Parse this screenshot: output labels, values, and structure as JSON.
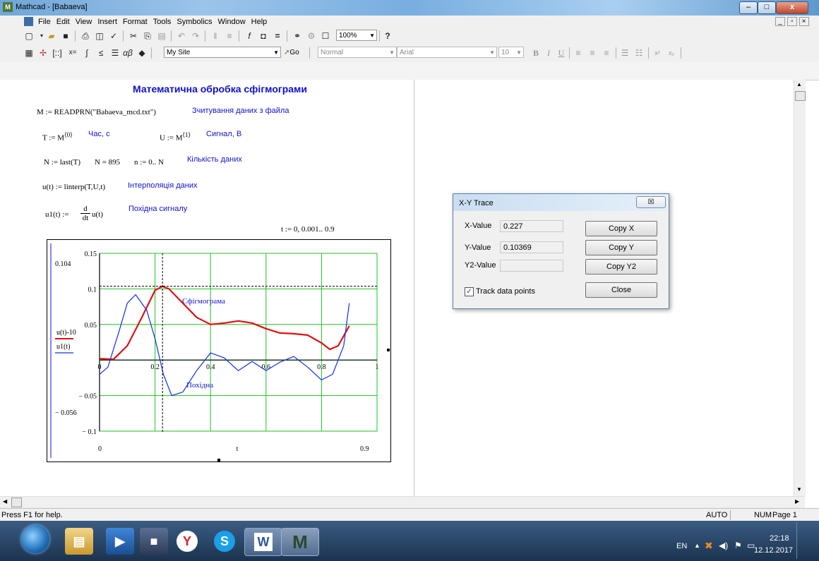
{
  "window": {
    "title": "Mathcad - [Babaeva]",
    "min": "–",
    "max": "□",
    "close": "x"
  },
  "menu": [
    "File",
    "Edit",
    "View",
    "Insert",
    "Format",
    "Tools",
    "Symbolics",
    "Window",
    "Help"
  ],
  "toolbar": {
    "zoom": "100%",
    "site": "My Site",
    "go": "Go",
    "style": "Normal",
    "font": "Arial",
    "size": "10",
    "bold": "B",
    "italic": "I",
    "underline": "U"
  },
  "worksheet": {
    "heading": "Математична обробка сфігмограми",
    "read_expr": "M := READPRN(\"Babaeva_mcd.txt\")",
    "read_comment": "Зчитування даних з файла",
    "t_def": "T := M",
    "t_sup": "⟨0⟩",
    "t_comment": "Час, с",
    "u_def": "U := M",
    "u_sup": "⟨1⟩",
    "u_comment": "Сигнал, В",
    "n_def": "N := last(T)",
    "n_val": "N = 895",
    "n_range": "n := 0.. N",
    "n_comment": "Кількість даних",
    "interp_def": "u(t) := linterp(T,U,t)",
    "interp_comment": "Інтерполяція даних",
    "deriv_lhs": "u1(t) :=",
    "deriv_d": "d",
    "deriv_dt": "dt",
    "deriv_rhs": "u(t)",
    "deriv_comment": "Похідна сигналу",
    "t_range": "t := 0, 0.001.. 0.9"
  },
  "dialog": {
    "title": "X-Y Trace",
    "x_label": "X-Value",
    "x_value": "0.227",
    "y_label": "Y-Value",
    "y_value": "0.10369",
    "y2_label": "Y2-Value",
    "y2_value": "",
    "copy_x": "Copy X",
    "copy_y": "Copy Y",
    "copy_y2": "Copy Y2",
    "close": "Close",
    "track_label": "Track data points",
    "track_checked": true
  },
  "status": {
    "help": "Press F1 for help.",
    "mode": "AUTO",
    "num": "NUM",
    "page": "Page 1"
  },
  "taskbar": {
    "lang": "EN",
    "time": "22:18",
    "date": "12.12.2017",
    "apps": [
      "windows-start",
      "file-explorer",
      "media-player",
      "save-app",
      "yandex-browser",
      "skype",
      "word",
      "mathcad"
    ]
  },
  "chart_data": {
    "type": "line",
    "xlim": [
      0,
      1
    ],
    "ylim": [
      -0.1,
      0.15
    ],
    "x_ticks": [
      "0",
      "0.2",
      "0.4",
      "0.6",
      "0.8",
      "1"
    ],
    "y_ticks": [
      "0.15",
      "0.1",
      "0.05",
      "-0.05",
      "-0.1"
    ],
    "x_axis_lower": "0",
    "x_axis_upper": "0.9",
    "x_axis_label": "t",
    "y_axis_upper": "0.104",
    "y_axis_lower": "-0.056",
    "legend": [
      "u(t)-10",
      "u1(t)"
    ],
    "annotations": [
      "Сфігмограма",
      "Похідна"
    ],
    "grid": true,
    "cursor": {
      "x": 0.227,
      "y": 0.10369
    },
    "series": [
      {
        "name": "u(t)-10",
        "color": "#e01010",
        "x": [
          0,
          0.05,
          0.1,
          0.15,
          0.2,
          0.227,
          0.25,
          0.3,
          0.35,
          0.4,
          0.45,
          0.5,
          0.55,
          0.6,
          0.65,
          0.7,
          0.75,
          0.8,
          0.83,
          0.86,
          0.9
        ],
        "y": [
          0.002,
          0.001,
          0.02,
          0.058,
          0.098,
          0.1037,
          0.1,
          0.08,
          0.06,
          0.05,
          0.052,
          0.055,
          0.052,
          0.044,
          0.038,
          0.037,
          0.035,
          0.024,
          0.015,
          0.02,
          0.048
        ]
      },
      {
        "name": "u1(t)",
        "color": "#1030e0",
        "x": [
          0,
          0.03,
          0.07,
          0.1,
          0.13,
          0.17,
          0.2,
          0.23,
          0.26,
          0.3,
          0.35,
          0.4,
          0.45,
          0.5,
          0.55,
          0.6,
          0.65,
          0.7,
          0.75,
          0.8,
          0.84,
          0.88,
          0.9
        ],
        "y": [
          -0.02,
          -0.01,
          0.04,
          0.08,
          0.092,
          0.07,
          0.03,
          -0.02,
          -0.05,
          -0.045,
          -0.015,
          0.01,
          0.003,
          -0.015,
          -0.002,
          -0.015,
          -0.003,
          0.005,
          -0.01,
          -0.028,
          -0.02,
          0.02,
          0.08
        ]
      }
    ]
  }
}
